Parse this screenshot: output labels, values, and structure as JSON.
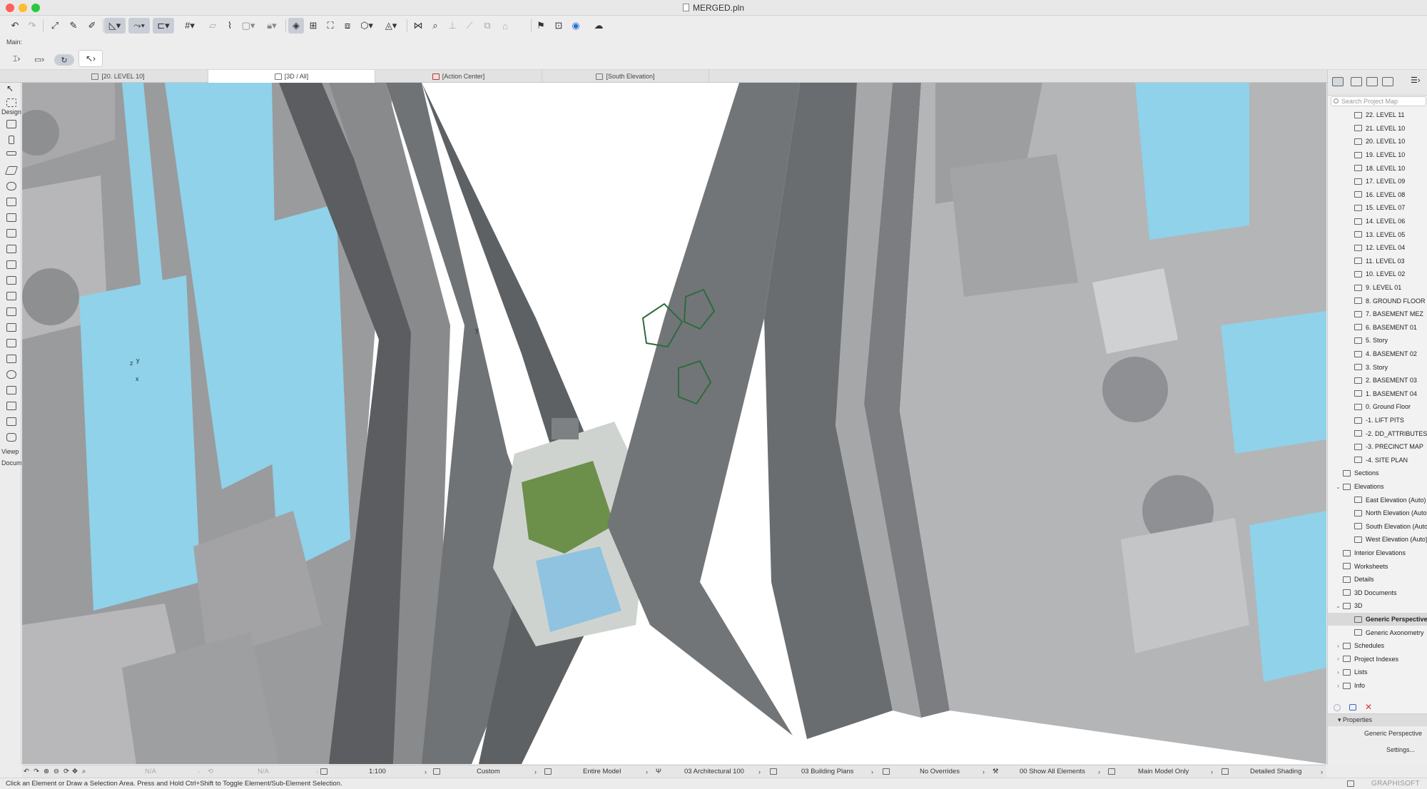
{
  "window": {
    "title": "MERGED.pln",
    "traffic_colors": {
      "close": "#fe5f57",
      "minimize": "#febc2e",
      "zoom": "#28c840"
    }
  },
  "infobox": {
    "label": "Main:"
  },
  "tabs": [
    {
      "label": "[20. LEVEL 10]"
    },
    {
      "label": "[3D / All]"
    },
    {
      "label": "[Action Center]"
    },
    {
      "label": "[South Elevation]"
    }
  ],
  "toolbox": {
    "design_label": "Design",
    "viewpoint_label": "Viewp",
    "document_label": "Docum"
  },
  "viewport": {
    "axis_y": "y",
    "axis_z": "z",
    "axis_x": "x",
    "sky_color": "#ffffff",
    "glass_color": "#8fd2ea",
    "facade_color": "#6f7274"
  },
  "navigator": {
    "search_placeholder": "Search Project Map",
    "items": [
      {
        "label": "22. LEVEL 11",
        "indent": 2
      },
      {
        "label": "21. LEVEL 10",
        "indent": 2
      },
      {
        "label": "20. LEVEL 10",
        "indent": 2
      },
      {
        "label": "19. LEVEL 10",
        "indent": 2
      },
      {
        "label": "18. LEVEL 10",
        "indent": 2
      },
      {
        "label": "17. LEVEL 09",
        "indent": 2
      },
      {
        "label": "16. LEVEL 08",
        "indent": 2
      },
      {
        "label": "15. LEVEL 07",
        "indent": 2
      },
      {
        "label": "14. LEVEL 06",
        "indent": 2
      },
      {
        "label": "13. LEVEL 05",
        "indent": 2
      },
      {
        "label": "12. LEVEL 04",
        "indent": 2
      },
      {
        "label": "11. LEVEL 03",
        "indent": 2
      },
      {
        "label": "10. LEVEL 02",
        "indent": 2
      },
      {
        "label": "9. LEVEL 01",
        "indent": 2
      },
      {
        "label": "8. GROUND FLOOR",
        "indent": 2
      },
      {
        "label": "7. BASEMENT MEZ",
        "indent": 2
      },
      {
        "label": "6. BASEMENT 01",
        "indent": 2
      },
      {
        "label": "5. Story",
        "indent": 2
      },
      {
        "label": "4. BASEMENT 02",
        "indent": 2
      },
      {
        "label": "3. Story",
        "indent": 2
      },
      {
        "label": "2. BASEMENT 03",
        "indent": 2
      },
      {
        "label": "1. BASEMENT 04",
        "indent": 2
      },
      {
        "label": "0. Ground Floor",
        "indent": 2
      },
      {
        "label": "-1. LIFT PITS",
        "indent": 2
      },
      {
        "label": "-2. DD_ATTRIBUTES",
        "indent": 2
      },
      {
        "label": "-3. PRECINCT MAP",
        "indent": 2
      },
      {
        "label": "-4. SITE PLAN",
        "indent": 2
      },
      {
        "label": "Sections",
        "indent": 1
      },
      {
        "label": "Elevations",
        "indent": 1,
        "expanded": true
      },
      {
        "label": "East Elevation (Auto)",
        "indent": 2
      },
      {
        "label": "North Elevation (Auto)",
        "indent": 2
      },
      {
        "label": "South Elevation (Auto)",
        "indent": 2
      },
      {
        "label": "West Elevation (Auto)",
        "indent": 2
      },
      {
        "label": "Interior Elevations",
        "indent": 1
      },
      {
        "label": "Worksheets",
        "indent": 1
      },
      {
        "label": "Details",
        "indent": 1
      },
      {
        "label": "3D Documents",
        "indent": 1
      },
      {
        "label": "3D",
        "indent": 1,
        "expanded": true
      },
      {
        "label": "Generic Perspective",
        "indent": 2,
        "selected": true
      },
      {
        "label": "Generic Axonometry",
        "indent": 2
      },
      {
        "label": "Schedules",
        "indent": 1,
        "collapsed": true
      },
      {
        "label": "Project Indexes",
        "indent": 1,
        "collapsed": true
      },
      {
        "label": "Lists",
        "indent": 1,
        "collapsed": true
      },
      {
        "label": "Info",
        "indent": 1,
        "collapsed": true
      }
    ],
    "properties_label": "Properties",
    "properties_value": "Generic Perspective",
    "settings_label": "Settings..."
  },
  "statusbar": {
    "na1": "N/A",
    "na2": "N/A",
    "scale": "1:100",
    "custom": "Custom",
    "model": "Entire Model",
    "pen": "03 Architectural 100",
    "layers": "03 Building Plans",
    "overrides": "No Overrides",
    "renovation": "00 Show All Elements",
    "mvo": "Main Model Only",
    "shading": "Detailed Shading"
  },
  "hint": "Click an Element or Draw a Selection Area. Press and Hold Ctrl+Shift to Toggle Element/Sub-Element Selection.",
  "brand": "GRAPHISOFT"
}
